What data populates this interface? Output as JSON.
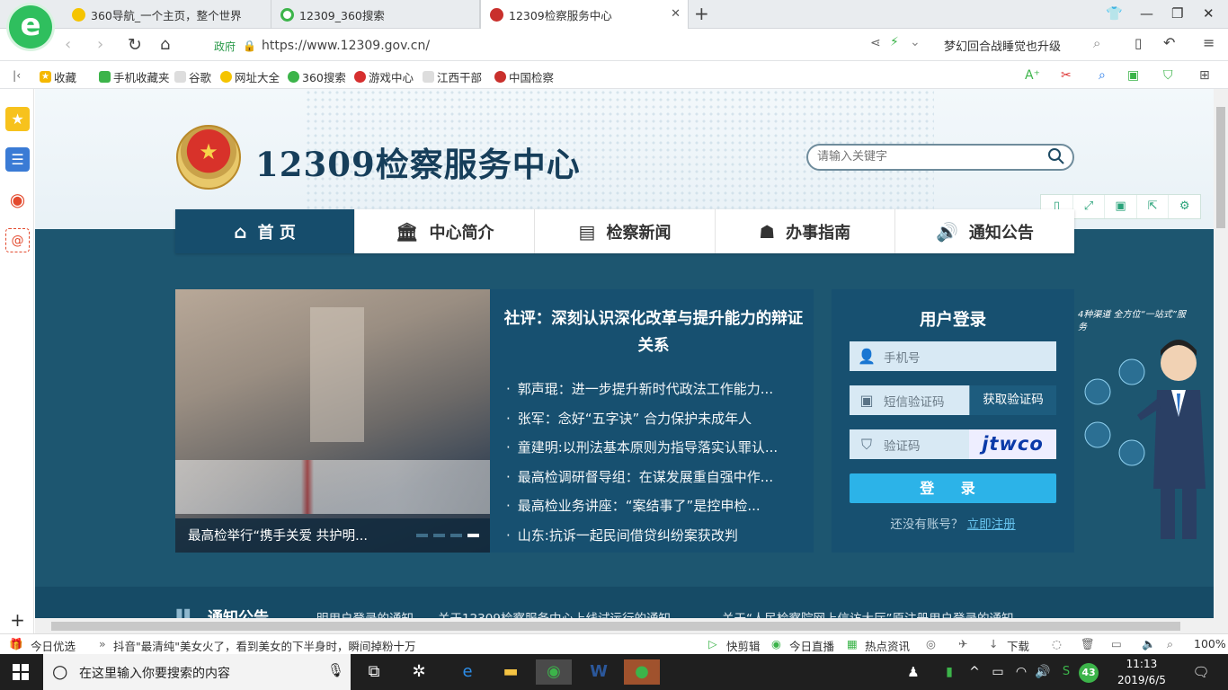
{
  "browser": {
    "tabs": [
      {
        "label": "360导航_一个主页，整个世界",
        "active": false
      },
      {
        "label": "12309_360搜索",
        "active": false
      },
      {
        "label": "12309检察服务中心",
        "active": true
      }
    ],
    "new_tab": "+",
    "gov_badge": "政府",
    "url": "https://www.12309.gov.cn/",
    "promo_text": "梦幻回合战睡觉也升级"
  },
  "bookmarks": [
    "收藏",
    "手机收藏夹",
    "谷歌",
    "网址大全",
    "360搜索",
    "游戏中心",
    "江西干部",
    "中国检察"
  ],
  "site": {
    "title": "12309检察服务中心",
    "search_placeholder": "请输入关键字",
    "menu": [
      "首 页",
      "中心简介",
      "检察新闻",
      "办事指南",
      "通知公告"
    ],
    "photo_caption": "最高检举行“携手关爱 共护明...",
    "headline": "社评：深刻认识深化改革与提升能力的辩证关系",
    "news": [
      "郭声琨：进一步提升新时代政法工作能力...",
      "张军：念好“五字诀” 合力保护未成年人",
      "童建明:以刑法基本原则为指导落实认罪认...",
      "最高检调研督导组：在谋发展重自强中作...",
      "最高检业务讲座：“案结事了”是控申检...",
      "山东:抗诉一起民间借贷纠纷案获改判"
    ],
    "login": {
      "title": "用户登录",
      "phone_placeholder": "手机号",
      "sms_placeholder": "短信验证码",
      "sms_button": "获取验证码",
      "captcha_placeholder": "验证码",
      "captcha_text": "jtwco",
      "submit": "登 录",
      "no_account": "还没有账号？",
      "register": "立即注册"
    },
    "mascot_text": "4种渠道 全方位“一站式”服务",
    "notice_title": "通知公告",
    "notice_items": [
      "……明用户登录的通知",
      "关于12309检察服务中心上线试运行的通知",
      "关于“人民检察院网上信访大厅”原注册用户登录的通知"
    ]
  },
  "statusbar": {
    "left": "今日优选",
    "news": "抖音\"最清纯\"美女火了，看到美女的下半身时，瞬间掉粉十万",
    "items": [
      "快剪辑",
      "今日直播",
      "热点资讯",
      "下载",
      "100%"
    ]
  },
  "taskbar": {
    "search_placeholder": "在这里输入你要搜索的内容",
    "badge": "43",
    "time": "11:13",
    "date": "2019/6/5"
  }
}
